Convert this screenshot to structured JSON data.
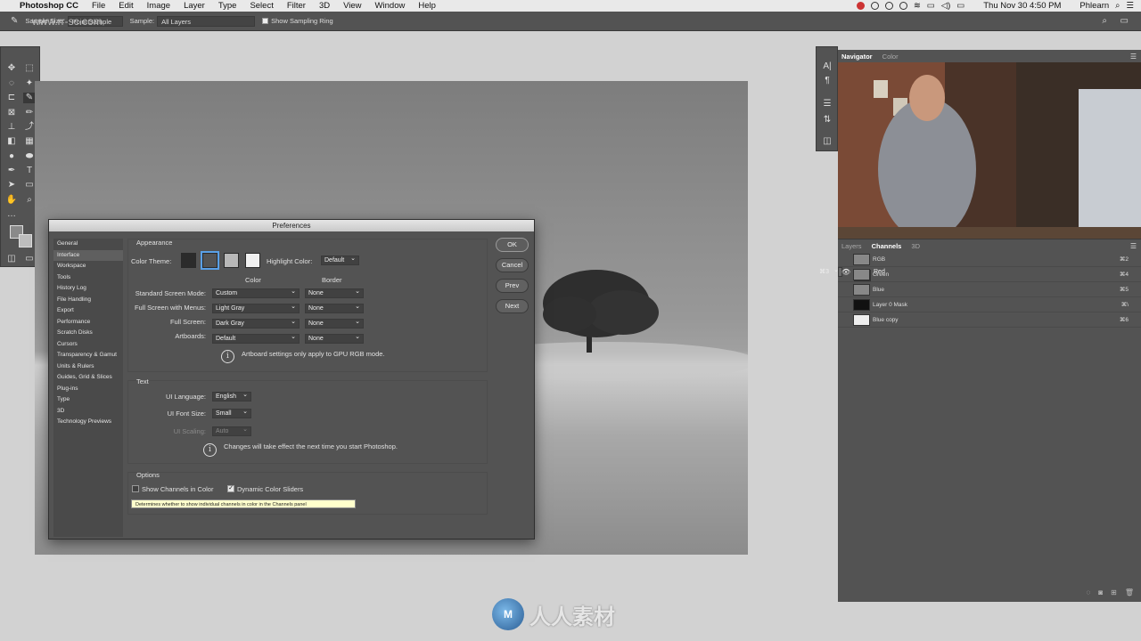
{
  "menubar": {
    "app": "Photoshop CC",
    "items": [
      "File",
      "Edit",
      "Image",
      "Layer",
      "Type",
      "Select",
      "Filter",
      "3D",
      "View",
      "Window",
      "Help"
    ],
    "datetime": "Thu Nov 30  4:50 PM",
    "user": "Phlearn"
  },
  "options": {
    "sample_size_label": "Sample Size:",
    "sample_size": "Point Sample",
    "sample_label": "Sample:",
    "sample": "All Layers",
    "show_ring": "Show Sampling Ring",
    "site_watermark": "www.rr-sc.com"
  },
  "nav_panel": {
    "tabs": [
      "Navigator",
      "Color"
    ]
  },
  "layers_panel": {
    "tabs": [
      "Layers",
      "Channels",
      "3D"
    ],
    "channels": [
      {
        "name": "RGB",
        "key": "⌘2"
      },
      {
        "name": "Red",
        "key": "⌘3"
      },
      {
        "name": "Green",
        "key": "⌘4"
      },
      {
        "name": "Blue",
        "key": "⌘5"
      },
      {
        "name": "Layer 0 Mask",
        "key": "⌘\\"
      },
      {
        "name": "Blue copy",
        "key": "⌘6"
      }
    ]
  },
  "dialog": {
    "title": "Preferences",
    "nav": [
      "General",
      "Interface",
      "Workspace",
      "Tools",
      "History Log",
      "File Handling",
      "Export",
      "Performance",
      "Scratch Disks",
      "Cursors",
      "Transparency & Gamut",
      "Units & Rulers",
      "Guides, Grid & Slices",
      "Plug-ins",
      "Type",
      "3D",
      "Technology Previews"
    ],
    "buttons": {
      "ok": "OK",
      "cancel": "Cancel",
      "prev": "Prev",
      "next": "Next"
    },
    "appearance": {
      "title": "Appearance",
      "color_theme_label": "Color Theme:",
      "highlight_label": "Highlight Color:",
      "highlight_value": "Default",
      "col_color": "Color",
      "col_border": "Border",
      "rows": [
        {
          "label": "Standard Screen Mode:",
          "color": "Custom",
          "border": "None"
        },
        {
          "label": "Full Screen with Menus:",
          "color": "Light Gray",
          "border": "None"
        },
        {
          "label": "Full Screen:",
          "color": "Dark Gray",
          "border": "None"
        },
        {
          "label": "Artboards:",
          "color": "Default",
          "border": "None"
        }
      ],
      "info": "Artboard settings only apply to GPU RGB mode."
    },
    "text": {
      "title": "Text",
      "lang_label": "UI Language:",
      "lang": "English",
      "size_label": "UI Font Size:",
      "size": "Small",
      "scale_label": "UI Scaling:",
      "scale": "Auto",
      "info": "Changes will take effect the next time you start Photoshop."
    },
    "options": {
      "title": "Options",
      "show_channels": "Show Channels in Color",
      "dynamic": "Dynamic Color Sliders",
      "tooltip": "Determines whether to show individual channels in color in the Channels panel"
    }
  },
  "watermark": {
    "text": "人人素材",
    "logo": "M"
  }
}
